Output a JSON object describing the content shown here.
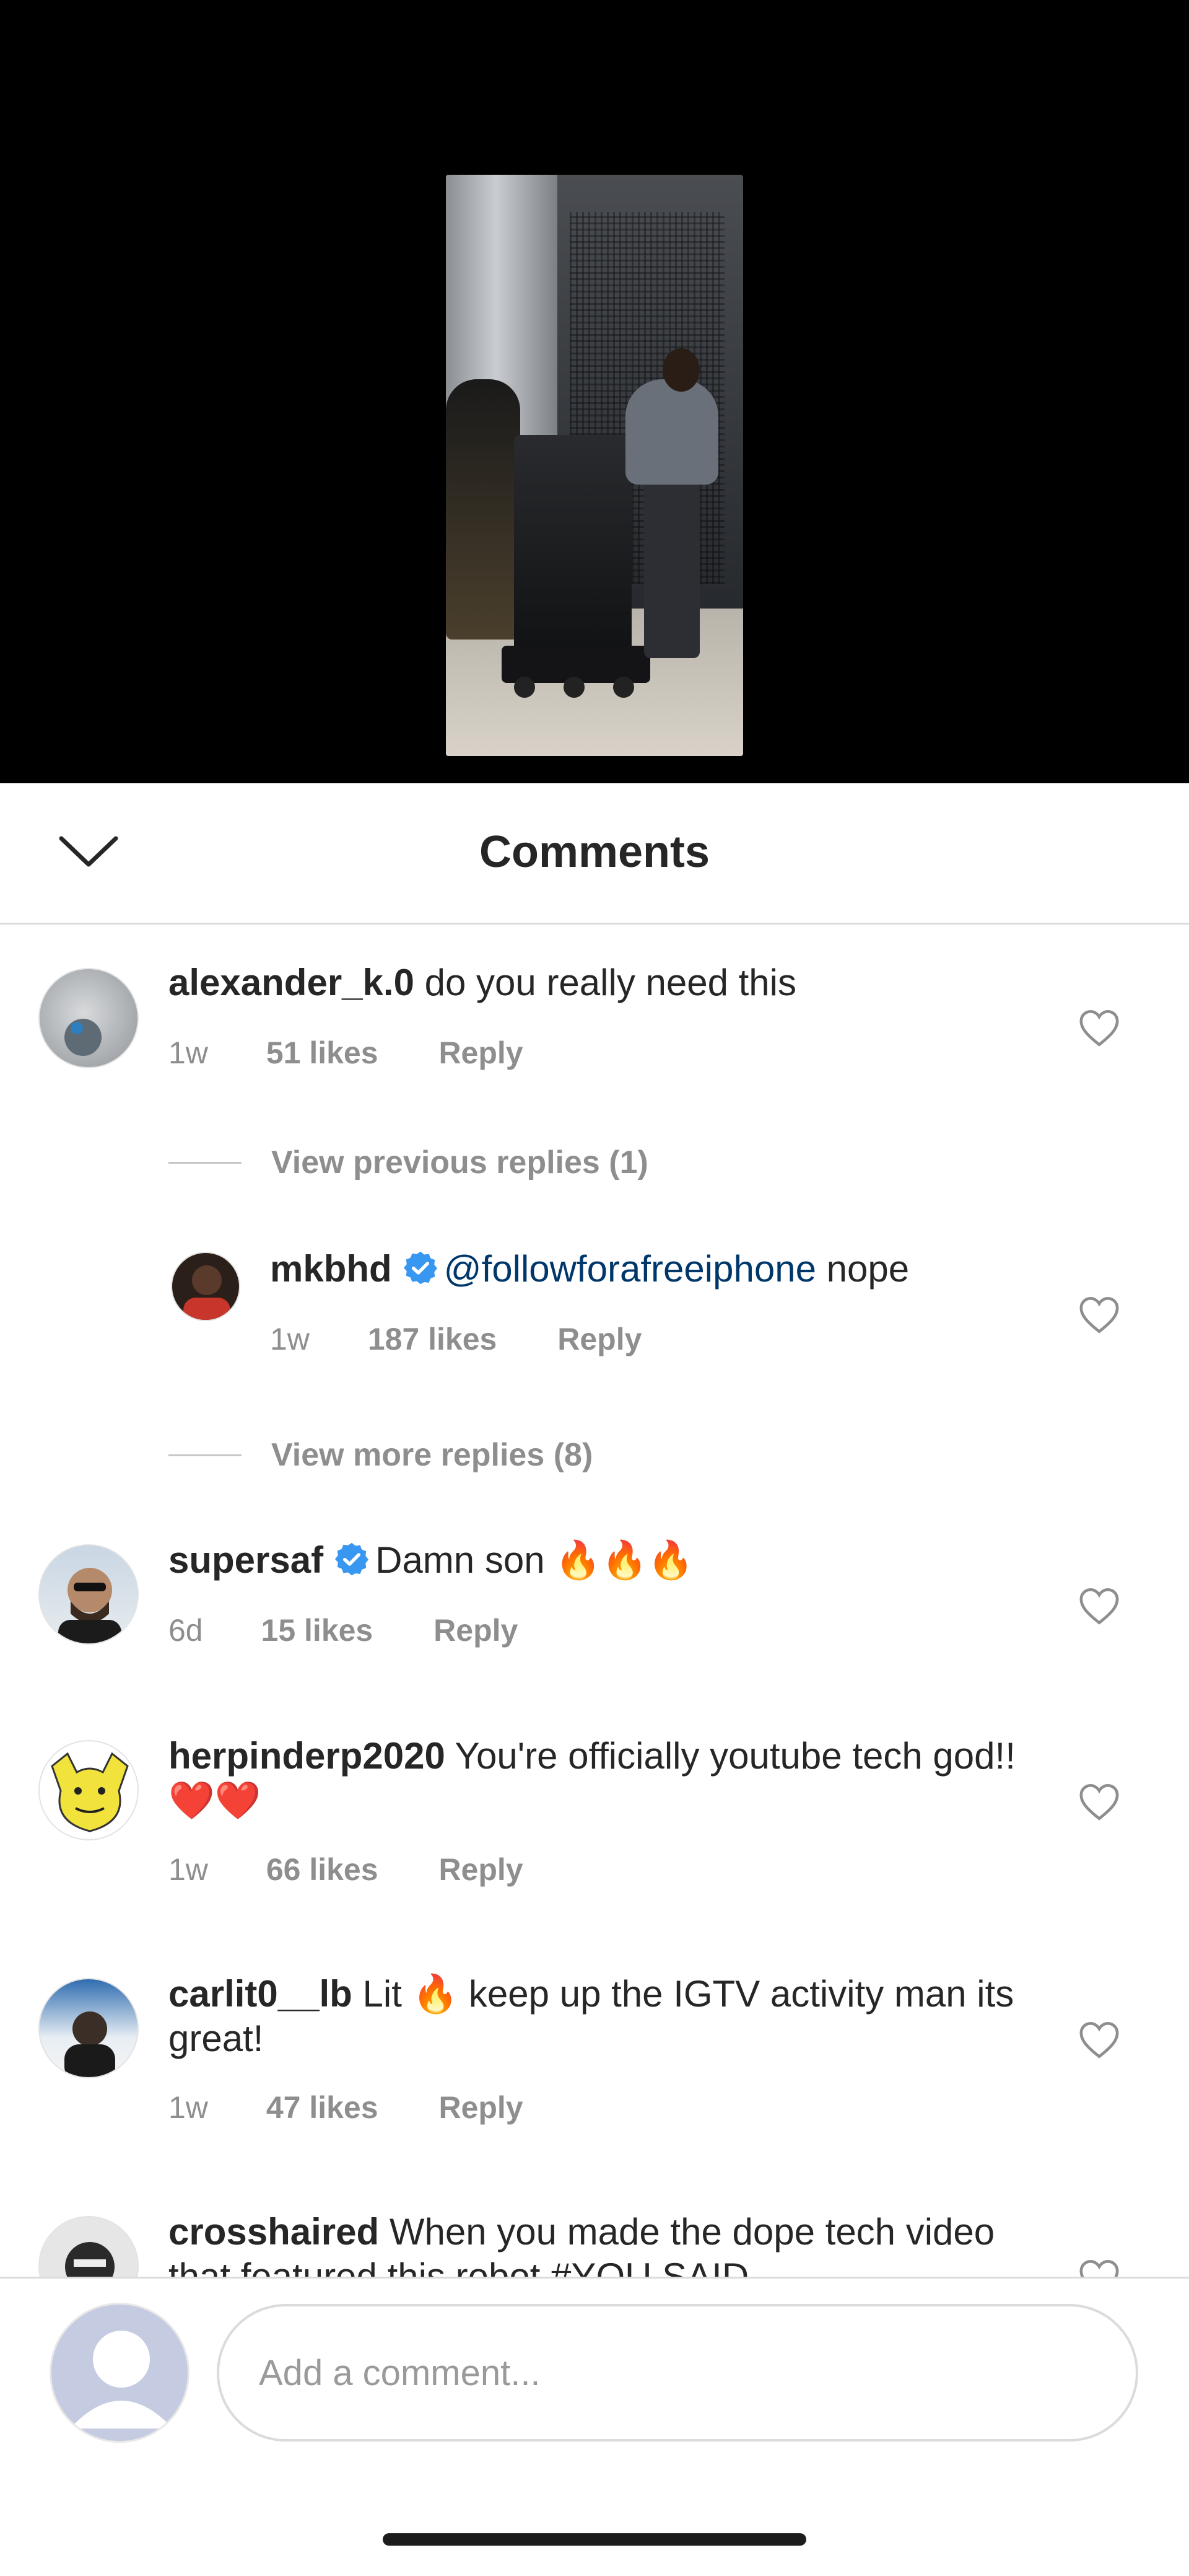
{
  "header": {
    "title": "Comments"
  },
  "comments": [
    {
      "username": "alexander_k.0",
      "text": "do you really need this",
      "time": "1w",
      "likes": "51 likes",
      "reply": "Reply"
    },
    {
      "type": "view_previous",
      "label": "View previous replies (1)"
    },
    {
      "username": "mkbhd",
      "mention": "@followforafreeiphone",
      "text": "nope",
      "time": "1w",
      "likes": "187 likes",
      "reply": "Reply"
    },
    {
      "type": "view_more",
      "label": "View more replies (8)"
    },
    {
      "username": "supersaf",
      "text": "Damn son 🔥🔥🔥",
      "time": "6d",
      "likes": "15 likes",
      "reply": "Reply"
    },
    {
      "username": "herpinderp2020",
      "text": "You're officially youtube tech god!! ❤️❤️",
      "time": "1w",
      "likes": "66 likes",
      "reply": "Reply"
    },
    {
      "username": "carlit0__lb",
      "text": "Lit 🔥 keep up the IGTV activity man its great!",
      "time": "1w",
      "likes": "47 likes",
      "reply": "Reply"
    },
    {
      "username": "crosshaired",
      "text": "When you made the dope tech video that featured this robot #YOU SAID"
    }
  ],
  "footer": {
    "placeholder": "Add a comment..."
  },
  "colors": {
    "accent_blue": "#3897f0",
    "mention": "#00376b",
    "muted": "#8e8e8e"
  }
}
